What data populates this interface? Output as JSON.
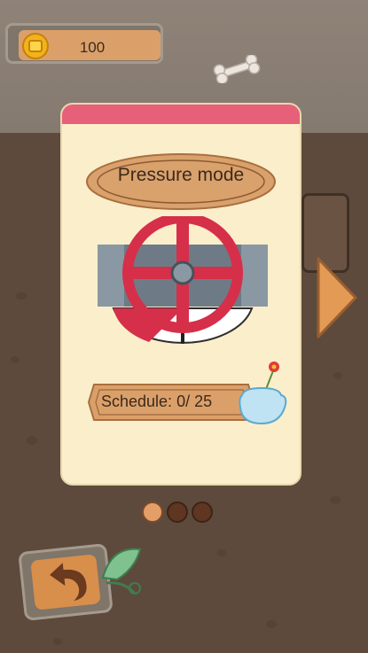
{
  "coins": {
    "value": "100",
    "icon": "coin-icon"
  },
  "card": {
    "title": "Pressure mode",
    "schedule_label": "Schedule:",
    "schedule_value": "0/ 25"
  },
  "pager": {
    "total": 3,
    "active": 0
  },
  "icons": {
    "next": "right-arrow-icon",
    "back": "back-arrow-icon",
    "valve": "valve-wheel-icon",
    "vase": "flower-vase-icon"
  },
  "colors": {
    "accent": "#e7607a",
    "card": "#fbeecb",
    "plank": "#dba06a",
    "valve_red": "#d62f4a"
  }
}
